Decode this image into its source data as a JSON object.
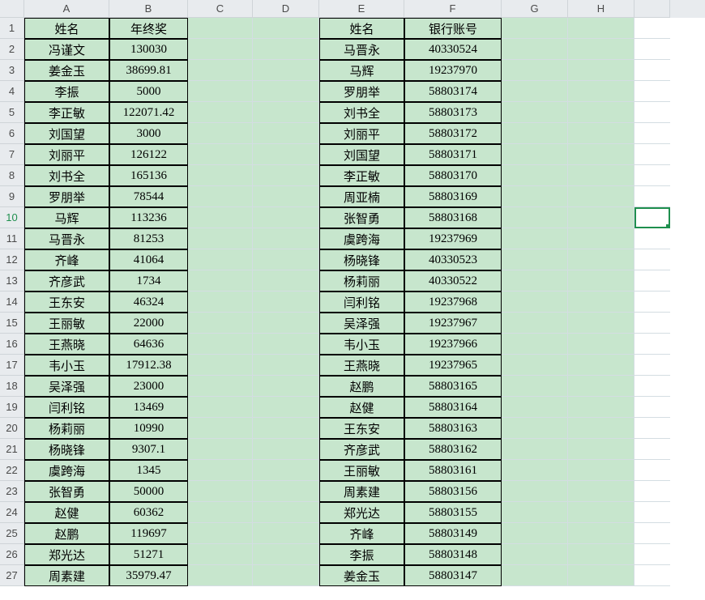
{
  "sheet": {
    "col_headers": [
      "A",
      "B",
      "C",
      "D",
      "E",
      "F",
      "G",
      "H",
      ""
    ],
    "row_count": 27,
    "selected_row": 10,
    "selected_col": "I",
    "chart_data": {
      "type": "table",
      "tables": [
        {
          "columns": [
            "姓名",
            "年终奖"
          ],
          "rows": [
            [
              "冯谨文",
              "130030"
            ],
            [
              "姜金玉",
              "38699.81"
            ],
            [
              "李振",
              "5000"
            ],
            [
              "李正敏",
              "122071.42"
            ],
            [
              "刘国望",
              "3000"
            ],
            [
              "刘丽平",
              "126122"
            ],
            [
              "刘书全",
              "165136"
            ],
            [
              "罗朋举",
              "78544"
            ],
            [
              "马辉",
              "113236"
            ],
            [
              "马晋永",
              "81253"
            ],
            [
              "齐峰",
              "41064"
            ],
            [
              "齐彦武",
              "1734"
            ],
            [
              "王东安",
              "46324"
            ],
            [
              "王丽敏",
              "22000"
            ],
            [
              "王燕晓",
              "64636"
            ],
            [
              "韦小玉",
              "17912.38"
            ],
            [
              "吴泽强",
              "23000"
            ],
            [
              "闫利铭",
              "13469"
            ],
            [
              "杨莉丽",
              "10990"
            ],
            [
              "杨晓锋",
              "9307.1"
            ],
            [
              "虞跨海",
              "1345"
            ],
            [
              "张智勇",
              "50000"
            ],
            [
              "赵健",
              "60362"
            ],
            [
              "赵鹏",
              "119697"
            ],
            [
              "郑光达",
              "51271"
            ],
            [
              "周素建",
              "35979.47"
            ]
          ]
        },
        {
          "columns": [
            "姓名",
            "银行账号"
          ],
          "rows": [
            [
              "马晋永",
              "40330524"
            ],
            [
              "马辉",
              "19237970"
            ],
            [
              "罗朋举",
              "58803174"
            ],
            [
              "刘书全",
              "58803173"
            ],
            [
              "刘丽平",
              "58803172"
            ],
            [
              "刘国望",
              "58803171"
            ],
            [
              "李正敏",
              "58803170"
            ],
            [
              "周亚楠",
              "58803169"
            ],
            [
              "张智勇",
              "58803168"
            ],
            [
              "虞跨海",
              "19237969"
            ],
            [
              "杨晓锋",
              "40330523"
            ],
            [
              "杨莉丽",
              "40330522"
            ],
            [
              "闫利铭",
              "19237968"
            ],
            [
              "吴泽强",
              "19237967"
            ],
            [
              "韦小玉",
              "19237966"
            ],
            [
              "王燕晓",
              "19237965"
            ],
            [
              "赵鹏",
              "58803165"
            ],
            [
              "赵健",
              "58803164"
            ],
            [
              "王东安",
              "58803163"
            ],
            [
              "齐彦武",
              "58803162"
            ],
            [
              "王丽敏",
              "58803161"
            ],
            [
              "周素建",
              "58803156"
            ],
            [
              "郑光达",
              "58803155"
            ],
            [
              "齐峰",
              "58803149"
            ],
            [
              "李振",
              "58803148"
            ],
            [
              "姜金玉",
              "58803147"
            ]
          ]
        }
      ]
    },
    "headers": {
      "t1c1": "姓名",
      "t1c2": "年终奖",
      "t2c1": "姓名",
      "t2c2": "银行账号"
    }
  }
}
